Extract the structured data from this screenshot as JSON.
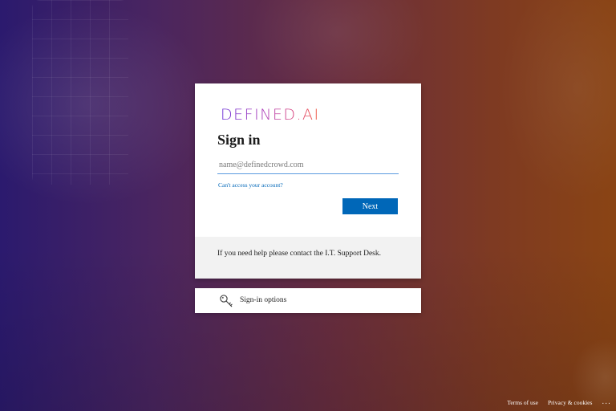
{
  "login": {
    "logo_text": "DEFINED.AI",
    "title": "Sign in",
    "email_placeholder": "name@definedcrowd.com",
    "email_value": "",
    "cant_access_link": "Can't access your account?",
    "next_button": "Next",
    "help_text": "If you need help please contact the I.T. Support Desk."
  },
  "signin_options": {
    "label": "Sign-in options",
    "icon": "key-icon"
  },
  "footer": {
    "terms": "Terms of use",
    "privacy": "Privacy & cookies",
    "more": "..."
  },
  "colors": {
    "accent": "#0067b8",
    "help_background": "#f2f2f2",
    "logo_gradient": [
      "#6a2fd6",
      "#e0426f"
    ]
  }
}
